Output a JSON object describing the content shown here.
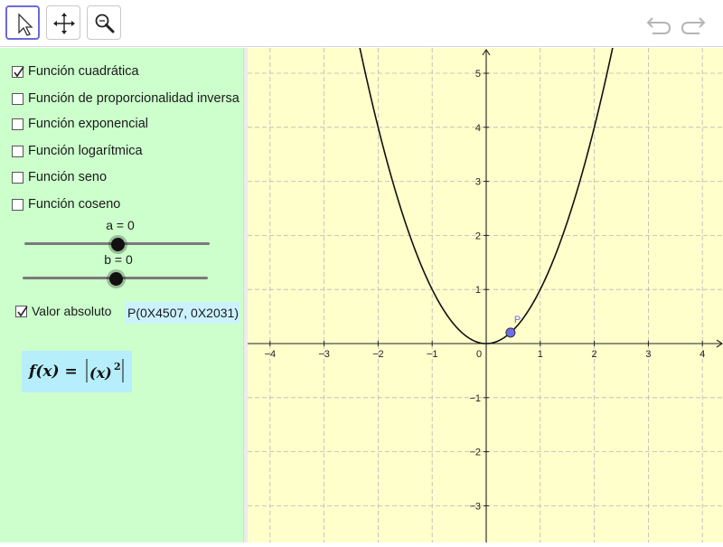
{
  "toolbar": {
    "tools": [
      {
        "name": "move",
        "icon": "arrow-pointer-icon",
        "active": true
      },
      {
        "name": "move-graphics-view",
        "icon": "move-cross-icon",
        "active": false
      },
      {
        "name": "zoom-in",
        "icon": "zoom-in-icon",
        "active": false
      }
    ],
    "undo_icon": "undo-icon",
    "redo_icon": "redo-icon"
  },
  "sidebar": {
    "functions": [
      {
        "label": "Función cuadrática",
        "checked": true
      },
      {
        "label": "Función de proporcionalidad inversa",
        "checked": false
      },
      {
        "label": "Función exponencial",
        "checked": false
      },
      {
        "label": "Función logarítmica",
        "checked": false
      },
      {
        "label": "Función seno",
        "checked": false
      },
      {
        "label": "Función coseno",
        "checked": false
      }
    ],
    "slider_a": {
      "label": "a = 0",
      "value": 0,
      "min": -5,
      "max": 5
    },
    "slider_b": {
      "label": "b = 0",
      "value": 0,
      "min": -5,
      "max": 5
    },
    "absolute": {
      "label": "Valor absoluto",
      "checked": true
    },
    "point_text": "P(0X4507, 0X2031)",
    "formula": {
      "lhs": "f(x) =",
      "base": "(x)",
      "exp": "2"
    }
  },
  "graph": {
    "background": "#ffffcc",
    "x_ticks": [
      "−4",
      "−3",
      "−2",
      "−1",
      "0",
      "1",
      "2",
      "3",
      "4"
    ],
    "y_ticks": [
      "5",
      "4",
      "3",
      "2",
      "1",
      "−1",
      "−2",
      "−3"
    ],
    "x_range": [
      -3.9,
      4.3
    ],
    "y_range": [
      -3.6,
      5.5
    ],
    "function": "f(x) = |x^2|",
    "point": {
      "label": "P",
      "x": 0.45,
      "y": 0.2031,
      "color": "#6d6dec"
    }
  }
}
